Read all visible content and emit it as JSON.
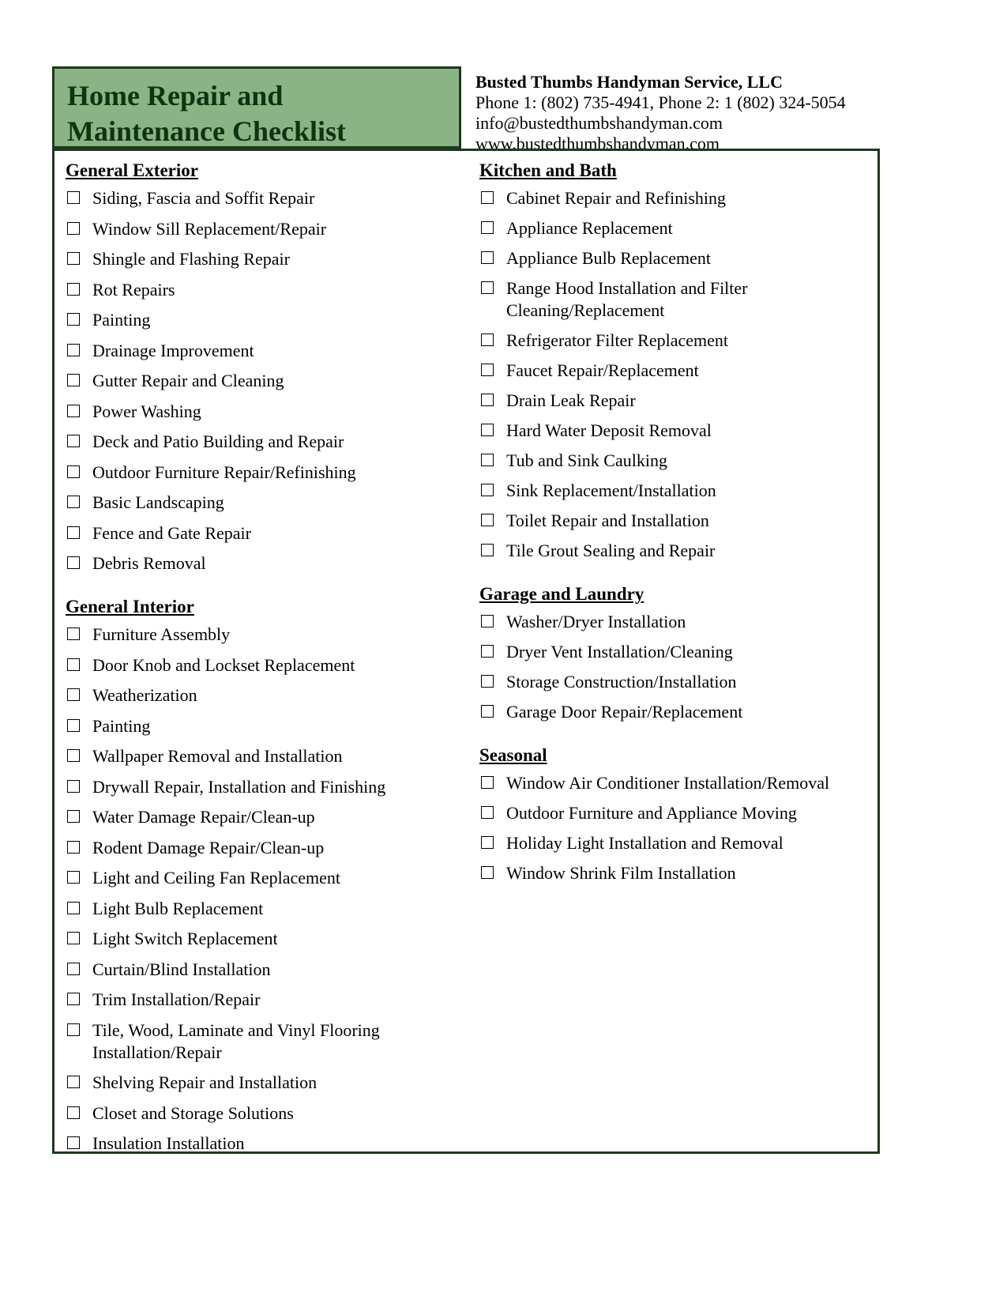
{
  "document": {
    "title_lines": [
      "Home Repair and",
      "Maintenance Checklist"
    ],
    "accent_color": "#8ab486",
    "border_color": "#1d3a1d",
    "title_color": "#113311"
  },
  "contact": {
    "company": "Busted Thumbs Handyman Service, LLC",
    "phones": "Phone 1: (802) 735-4941, Phone 2: 1 (802) 324-5054",
    "email": "info@bustedthumbshandyman.com",
    "website": "www.bustedthumbshandyman.com"
  },
  "left_column": [
    {
      "heading": "General Exterior",
      "items": [
        "Siding, Fascia and Soffit Repair",
        "Window Sill Replacement/Repair",
        "Shingle and Flashing Repair",
        "Rot Repairs",
        "Painting",
        "Drainage Improvement",
        "Gutter Repair and Cleaning",
        "Power Washing",
        "Deck and Patio Building and Repair",
        "Outdoor Furniture Repair/Refinishing",
        "Basic Landscaping",
        "Fence and Gate Repair",
        "Debris Removal"
      ]
    },
    {
      "heading": "General Interior",
      "items": [
        "Furniture Assembly",
        "Door Knob and Lockset Replacement",
        "Weatherization",
        "Painting",
        "Wallpaper Removal and Installation",
        "Drywall Repair, Installation and Finishing",
        "Water Damage Repair/Clean-up",
        "Rodent Damage Repair/Clean-up",
        "Light and Ceiling Fan Replacement",
        "Light Bulb Replacement",
        "Light Switch Replacement",
        "Curtain/Blind Installation",
        "Trim Installation/Repair",
        "Tile, Wood, Laminate and Vinyl Flooring Installation/Repair",
        "Shelving Repair and Installation",
        "Closet and Storage Solutions",
        "Insulation Installation"
      ]
    }
  ],
  "right_column": [
    {
      "heading": "Kitchen and Bath",
      "items": [
        "Cabinet Repair and Refinishing",
        "Appliance Replacement",
        "Appliance Bulb Replacement",
        "Range Hood Installation and Filter Cleaning/Replacement",
        "Refrigerator Filter Replacement",
        "Faucet Repair/Replacement",
        "Drain Leak Repair",
        "Hard Water Deposit Removal",
        "Tub and Sink Caulking",
        "Sink Replacement/Installation",
        "Toilet Repair and Installation",
        "Tile Grout Sealing and Repair"
      ]
    },
    {
      "heading": "Garage and Laundry",
      "items": [
        "Washer/Dryer Installation",
        "Dryer Vent Installation/Cleaning",
        "Storage Construction/Installation",
        "Garage Door Repair/Replacement"
      ]
    },
    {
      "heading": "Seasonal",
      "items": [
        "Window Air Conditioner Installation/Removal",
        "Outdoor Furniture and Appliance Moving",
        "Holiday Light Installation and Removal",
        "Window Shrink Film Installation"
      ]
    }
  ]
}
